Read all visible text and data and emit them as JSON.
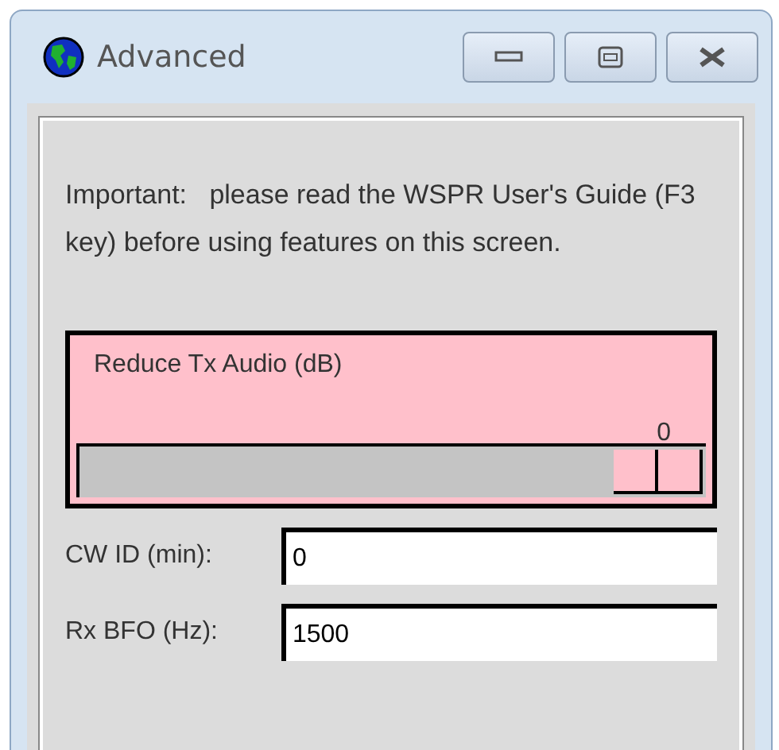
{
  "window": {
    "title": "Advanced"
  },
  "notice": "Important:   please read the WSPR User's Guide (F3 key) before using features on this screen.",
  "slider": {
    "label": "Reduce Tx Audio (dB)",
    "reading": "0",
    "level": 1
  },
  "fields": [
    {
      "label": "CW ID (min):",
      "value": "0"
    },
    {
      "label": "Rx BFO (Hz):",
      "value": "1500"
    }
  ]
}
